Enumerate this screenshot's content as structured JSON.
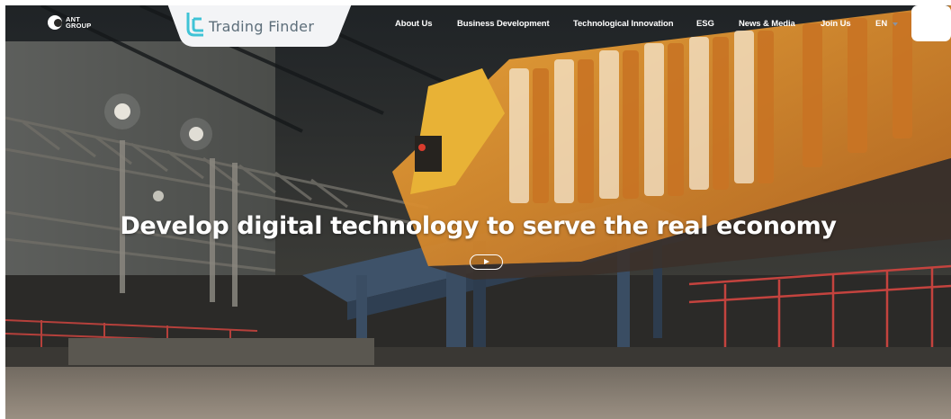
{
  "brand": {
    "name": "ANT GROUP"
  },
  "watermark": {
    "name": "Trading Finder"
  },
  "nav": {
    "items": [
      {
        "label": "About Us"
      },
      {
        "label": "Business Development"
      },
      {
        "label": "Technological Innovation"
      },
      {
        "label": "ESG"
      },
      {
        "label": "News & Media"
      },
      {
        "label": "Join Us"
      }
    ],
    "language": "EN"
  },
  "hero": {
    "headline": "Develop digital technology to serve the real economy",
    "play_icon": "play-icon"
  },
  "colors": {
    "nav_text": "#ffffff",
    "watermark_text": "#5d6e7a",
    "watermark_accent": "#3fc3d6",
    "machine_orange": "#e2902c",
    "steel_blue": "#4a5f78"
  }
}
